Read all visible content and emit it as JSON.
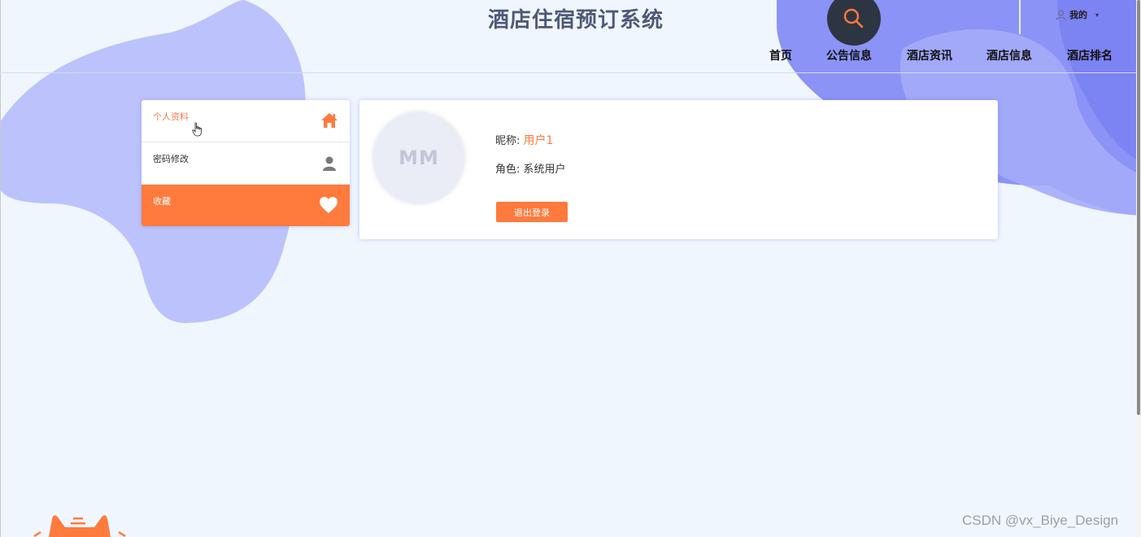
{
  "header": {
    "site_title": "酒店住宿预订系统",
    "search_icon": "search-icon",
    "user_menu_label": "我的",
    "user_icon": "user-icon",
    "caret": "▾"
  },
  "nav": {
    "items": [
      "首页",
      "公告信息",
      "酒店资讯",
      "酒店信息",
      "酒店排名"
    ]
  },
  "sidebar": {
    "items": [
      {
        "label": "个人资料",
        "icon": "home-icon",
        "state": "active"
      },
      {
        "label": "密码修改",
        "icon": "user-icon",
        "state": "normal"
      },
      {
        "label": "收藏",
        "icon": "heart-icon",
        "state": "highlighted"
      }
    ]
  },
  "profile": {
    "avatar_text": "MM",
    "nickname_label": "昵称:",
    "nickname_value": "用户1",
    "role_label": "角色:",
    "role_value": "系统用户",
    "logout_label": "退出登录"
  },
  "watermark": "CSDN @vx_Biye_Design",
  "colors": {
    "accent": "#ff7a3d",
    "title": "#4d5a78",
    "blob": "#a9b1fb",
    "background": "#f0f6fe",
    "search_bg": "#2e3542"
  }
}
